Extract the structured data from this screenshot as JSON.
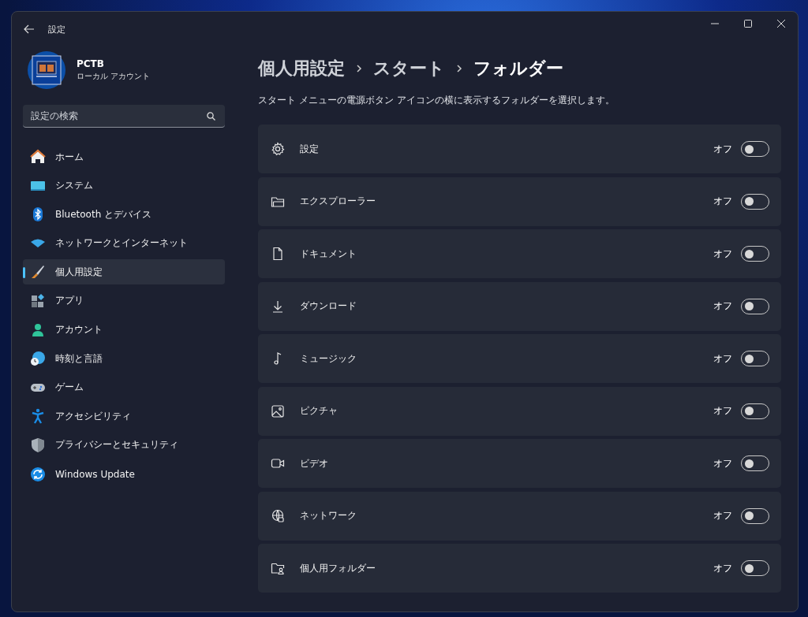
{
  "window": {
    "title": "設定"
  },
  "account": {
    "name": "PCTB",
    "type": "ローカル アカウント"
  },
  "search": {
    "placeholder": "設定の検索"
  },
  "sidebar": {
    "items": [
      {
        "label": "ホーム",
        "selected": false
      },
      {
        "label": "システム",
        "selected": false
      },
      {
        "label": "Bluetooth とデバイス",
        "selected": false
      },
      {
        "label": "ネットワークとインターネット",
        "selected": false
      },
      {
        "label": "個人用設定",
        "selected": true
      },
      {
        "label": "アプリ",
        "selected": false
      },
      {
        "label": "アカウント",
        "selected": false
      },
      {
        "label": "時刻と言語",
        "selected": false
      },
      {
        "label": "ゲーム",
        "selected": false
      },
      {
        "label": "アクセシビリティ",
        "selected": false
      },
      {
        "label": "プライバシーとセキュリティ",
        "selected": false
      },
      {
        "label": "Windows Update",
        "selected": false
      }
    ]
  },
  "breadcrumb": [
    "個人用設定",
    "スタート",
    "フォルダー"
  ],
  "description": "スタート メニューの電源ボタン アイコンの横に表示するフォルダーを選択します。",
  "folders": [
    {
      "label": "設定",
      "on": false,
      "state": "オフ"
    },
    {
      "label": "エクスプローラー",
      "on": false,
      "state": "オフ"
    },
    {
      "label": "ドキュメント",
      "on": false,
      "state": "オフ"
    },
    {
      "label": "ダウンロード",
      "on": false,
      "state": "オフ"
    },
    {
      "label": "ミュージック",
      "on": false,
      "state": "オフ"
    },
    {
      "label": "ピクチャ",
      "on": false,
      "state": "オフ"
    },
    {
      "label": "ビデオ",
      "on": false,
      "state": "オフ"
    },
    {
      "label": "ネットワーク",
      "on": false,
      "state": "オフ"
    },
    {
      "label": "個人用フォルダー",
      "on": false,
      "state": "オフ"
    }
  ]
}
